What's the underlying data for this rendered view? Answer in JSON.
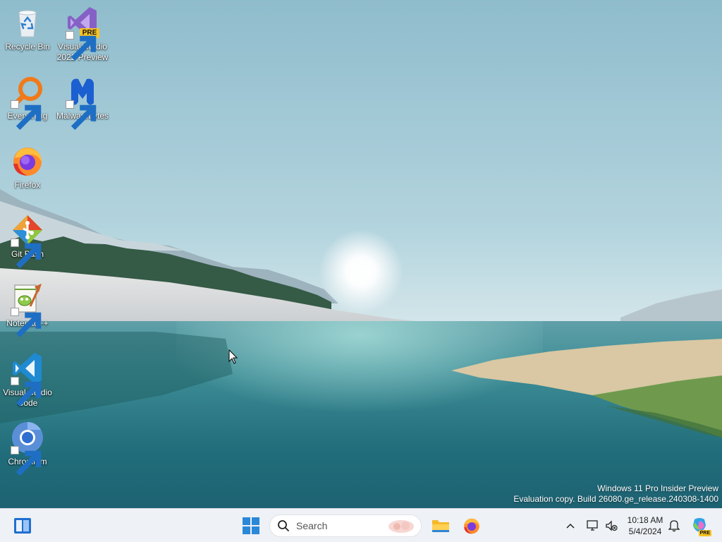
{
  "desktop": {
    "icons": [
      {
        "label": "Recycle Bin",
        "icon": "recycle-bin-icon",
        "shortcut": false
      },
      {
        "label": "Visual Studio 2022 Preview",
        "icon": "visual-studio-icon",
        "badge": "PRE",
        "shortcut": true
      },
      {
        "label": "Everything",
        "icon": "everything-icon",
        "shortcut": true
      },
      {
        "label": "Malwarebytes",
        "icon": "malwarebytes-icon",
        "shortcut": true
      },
      {
        "label": "Firefox",
        "icon": "firefox-icon",
        "shortcut": false
      },
      {
        "label": "Git Bash",
        "icon": "git-bash-icon",
        "shortcut": true
      },
      {
        "label": "Notepad++",
        "icon": "notepad-plus-plus-icon",
        "shortcut": true
      },
      {
        "label": "Visual Studio Code",
        "icon": "vscode-icon",
        "shortcut": true
      },
      {
        "label": "Chromium",
        "icon": "chromium-icon",
        "shortcut": true
      }
    ],
    "watermark": {
      "line1": "Windows 11 Pro Insider Preview",
      "line2": "Evaluation copy. Build 26080.ge_release.240308-1400"
    }
  },
  "taskbar": {
    "search": {
      "placeholder": "Search"
    },
    "pinned": [
      "widgets-icon",
      "start-icon",
      "file-explorer-icon",
      "firefox-icon"
    ],
    "tray": [
      "chevron-up-icon",
      "network-icon",
      "volume-muted-icon",
      "notification-bell-icon",
      "copilot-icon"
    ],
    "copilot_badge": "PRE",
    "clock": {
      "time": "10:18 AM",
      "date": "5/4/2024"
    }
  },
  "colors": {
    "taskbar": "#eef1f5",
    "accent": "#0067c0",
    "sky": "#a9cfdc",
    "water": "#2f7f8c"
  }
}
